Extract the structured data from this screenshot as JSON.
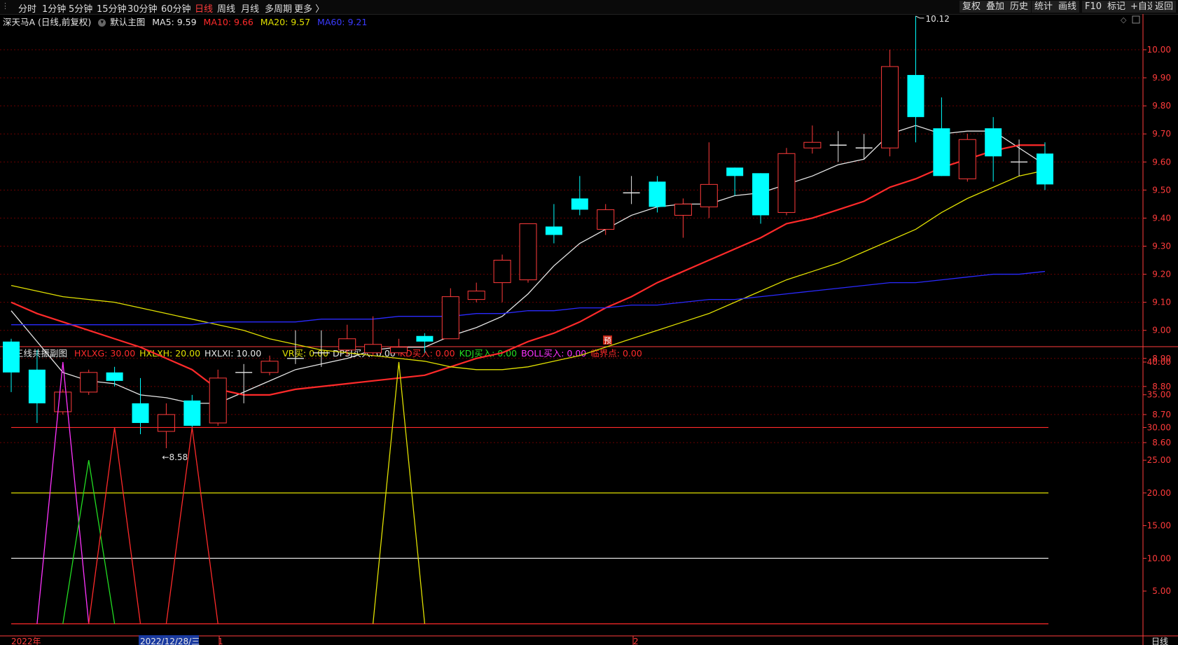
{
  "toolbar": {
    "left": [
      {
        "label": "分时",
        "active": false
      },
      {
        "label": "1分钟",
        "active": false
      },
      {
        "label": "5分钟",
        "active": false
      },
      {
        "label": "15分钟",
        "active": false
      },
      {
        "label": "30分钟",
        "active": false
      },
      {
        "label": "60分钟",
        "active": false
      },
      {
        "label": "日线",
        "active": true
      },
      {
        "label": "周线",
        "active": false
      },
      {
        "label": "月线",
        "active": false
      },
      {
        "label": "多周期",
        "active": false
      },
      {
        "label": "更多 〉",
        "active": false
      }
    ],
    "right": [
      "复权",
      "叠加",
      "历史",
      "统计",
      "画线",
      "F10",
      "标记",
      "+自选",
      "返回"
    ]
  },
  "main_info": {
    "stock": "深天马A (日线,前复权)",
    "template": "默认主图",
    "ma5": {
      "label": "MA5: 9.59",
      "color": "#e6e6e6"
    },
    "ma10": {
      "label": "MA10: 9.66",
      "color": "#ff2a2a"
    },
    "ma20": {
      "label": "MA20: 9.57",
      "color": "#e0e000"
    },
    "ma60": {
      "label": "MA60: 9.21",
      "color": "#2a2aff"
    }
  },
  "sub_info": {
    "title": "三线共振副图",
    "items": [
      {
        "label": "HXLXG: 30.00",
        "color": "#ff2a2a"
      },
      {
        "label": "HXLXH: 20.00",
        "color": "#e0e000"
      },
      {
        "label": "HXLXI: 10.00",
        "color": "#e6e6e6"
      },
      {
        "label": "VR买: 0.00",
        "color": "#e0e000"
      },
      {
        "label": "DPSJ买入: 0.00",
        "color": "#e6e6e6"
      },
      {
        "label": "KD买入: 0.00",
        "color": "#ff2a2a"
      },
      {
        "label": "KDJ买入: 0.00",
        "color": "#22dd22"
      },
      {
        "label": "BOLL买入: 0.00",
        "color": "#ff33ff"
      },
      {
        "label": "临界点: 0.00",
        "color": "#ff2a2a"
      }
    ]
  },
  "bottom": {
    "year_label": "2022年",
    "cursor_date": "2022/12/28/三",
    "month_1": "1",
    "month_2": "2",
    "period": "日线"
  },
  "marker_yu": "预",
  "colors": {
    "up": "#ff3b3b",
    "down": "#00ffff",
    "bg": "#000000",
    "grid": "#5a0000",
    "axis": "#ff3b3b"
  },
  "chart_data": [
    {
      "type": "candlestick",
      "title": "深天马A (日线,前复权)",
      "ylim": [
        8.55,
        10.2
      ],
      "yticks": [
        8.6,
        8.7,
        8.8,
        8.9,
        9.0,
        9.1,
        9.2,
        9.3,
        9.4,
        9.5,
        9.6,
        9.7,
        9.8,
        9.9,
        10.0
      ],
      "annotations": [
        {
          "text": "10.12",
          "index": 35,
          "kind": "high"
        },
        {
          "text": "8.58",
          "index": 6,
          "kind": "low"
        }
      ],
      "candles": [
        {
          "o": 8.96,
          "h": 8.97,
          "l": 8.78,
          "c": 8.85
        },
        {
          "o": 8.86,
          "h": 8.93,
          "l": 8.67,
          "c": 8.74
        },
        {
          "o": 8.71,
          "h": 8.79,
          "l": 8.7,
          "c": 8.78
        },
        {
          "o": 8.78,
          "h": 8.86,
          "l": 8.77,
          "c": 8.85
        },
        {
          "o": 8.85,
          "h": 8.87,
          "l": 8.8,
          "c": 8.82
        },
        {
          "o": 8.74,
          "h": 8.83,
          "l": 8.63,
          "c": 8.67
        },
        {
          "o": 8.64,
          "h": 8.74,
          "l": 8.58,
          "c": 8.7
        },
        {
          "o": 8.75,
          "h": 8.77,
          "l": 8.64,
          "c": 8.66
        },
        {
          "o": 8.67,
          "h": 8.86,
          "l": 8.66,
          "c": 8.83
        },
        {
          "o": 8.85,
          "h": 8.88,
          "l": 8.74,
          "c": 8.85
        },
        {
          "o": 8.85,
          "h": 8.91,
          "l": 8.84,
          "c": 8.89
        },
        {
          "o": 8.9,
          "h": 9.0,
          "l": 8.88,
          "c": 8.9
        },
        {
          "o": 8.92,
          "h": 9.0,
          "l": 8.87,
          "c": 8.92
        },
        {
          "o": 8.93,
          "h": 9.02,
          "l": 8.91,
          "c": 8.97
        },
        {
          "o": 8.92,
          "h": 9.05,
          "l": 8.91,
          "c": 8.95
        },
        {
          "o": 8.92,
          "h": 8.97,
          "l": 8.91,
          "c": 8.94
        },
        {
          "o": 8.98,
          "h": 8.99,
          "l": 8.92,
          "c": 8.96
        },
        {
          "o": 8.97,
          "h": 9.15,
          "l": 8.97,
          "c": 9.12
        },
        {
          "o": 9.11,
          "h": 9.17,
          "l": 9.1,
          "c": 9.14
        },
        {
          "o": 9.17,
          "h": 9.27,
          "l": 9.1,
          "c": 9.25
        },
        {
          "o": 9.18,
          "h": 9.38,
          "l": 9.17,
          "c": 9.38
        },
        {
          "o": 9.37,
          "h": 9.45,
          "l": 9.31,
          "c": 9.34
        },
        {
          "o": 9.47,
          "h": 9.55,
          "l": 9.41,
          "c": 9.43
        },
        {
          "o": 9.36,
          "h": 9.45,
          "l": 9.34,
          "c": 9.43
        },
        {
          "o": 9.48,
          "h": 9.55,
          "l": 9.45,
          "c": 9.49
        },
        {
          "o": 9.53,
          "h": 9.55,
          "l": 9.42,
          "c": 9.44
        },
        {
          "o": 9.41,
          "h": 9.47,
          "l": 9.33,
          "c": 9.45
        },
        {
          "o": 9.44,
          "h": 9.67,
          "l": 9.4,
          "c": 9.52
        },
        {
          "o": 9.58,
          "h": 9.58,
          "l": 9.48,
          "c": 9.55
        },
        {
          "o": 9.56,
          "h": 9.56,
          "l": 9.38,
          "c": 9.41
        },
        {
          "o": 9.42,
          "h": 9.65,
          "l": 9.41,
          "c": 9.63
        },
        {
          "o": 9.65,
          "h": 9.73,
          "l": 9.63,
          "c": 9.67
        },
        {
          "o": 9.66,
          "h": 9.71,
          "l": 9.6,
          "c": 9.66
        },
        {
          "o": 9.64,
          "h": 9.7,
          "l": 9.61,
          "c": 9.65
        },
        {
          "o": 9.65,
          "h": 10.0,
          "l": 9.62,
          "c": 9.94
        },
        {
          "o": 9.91,
          "h": 10.12,
          "l": 9.67,
          "c": 9.76
        },
        {
          "o": 9.72,
          "h": 9.83,
          "l": 9.55,
          "c": 9.55
        },
        {
          "o": 9.54,
          "h": 9.7,
          "l": 9.53,
          "c": 9.68
        },
        {
          "o": 9.72,
          "h": 9.76,
          "l": 9.53,
          "c": 9.62
        },
        {
          "o": 9.6,
          "h": 9.68,
          "l": 9.55,
          "c": 9.6
        },
        {
          "o": 9.63,
          "h": 9.67,
          "l": 9.5,
          "c": 9.52
        }
      ],
      "series": [
        {
          "name": "MA5",
          "color": "#e6e6e6",
          "values": [
            9.07,
            8.96,
            8.85,
            8.82,
            8.81,
            8.77,
            8.76,
            8.74,
            8.74,
            8.78,
            8.82,
            8.86,
            8.88,
            8.9,
            8.93,
            8.94,
            8.94,
            8.98,
            9.01,
            9.05,
            9.13,
            9.23,
            9.31,
            9.36,
            9.41,
            9.44,
            9.45,
            9.45,
            9.48,
            9.49,
            9.52,
            9.55,
            9.59,
            9.61,
            9.7,
            9.73,
            9.7,
            9.71,
            9.71,
            9.65,
            9.59
          ]
        },
        {
          "name": "MA10",
          "color": "#ff2a2a",
          "values": [
            9.1,
            9.06,
            9.03,
            9.0,
            8.97,
            8.94,
            8.9,
            8.86,
            8.79,
            8.77,
            8.77,
            8.79,
            8.8,
            8.81,
            8.82,
            8.83,
            8.84,
            8.87,
            8.9,
            8.92,
            8.96,
            8.99,
            9.03,
            9.08,
            9.12,
            9.17,
            9.21,
            9.25,
            9.29,
            9.33,
            9.38,
            9.4,
            9.43,
            9.46,
            9.51,
            9.54,
            9.58,
            9.61,
            9.64,
            9.66,
            9.66
          ]
        },
        {
          "name": "MA20",
          "color": "#e0e000",
          "values": [
            9.16,
            9.14,
            9.12,
            9.11,
            9.1,
            9.08,
            9.06,
            9.04,
            9.02,
            9.0,
            8.97,
            8.95,
            8.93,
            8.92,
            8.91,
            8.9,
            8.89,
            8.87,
            8.86,
            8.86,
            8.87,
            8.89,
            8.91,
            8.94,
            8.97,
            9.0,
            9.03,
            9.06,
            9.1,
            9.14,
            9.18,
            9.21,
            9.24,
            9.28,
            9.32,
            9.36,
            9.42,
            9.47,
            9.51,
            9.55,
            9.57
          ]
        },
        {
          "name": "MA60",
          "color": "#2a2aff",
          "values": [
            9.02,
            9.02,
            9.02,
            9.02,
            9.02,
            9.02,
            9.02,
            9.02,
            9.03,
            9.03,
            9.03,
            9.03,
            9.04,
            9.04,
            9.04,
            9.05,
            9.05,
            9.05,
            9.06,
            9.06,
            9.07,
            9.07,
            9.08,
            9.08,
            9.09,
            9.09,
            9.1,
            9.11,
            9.11,
            9.12,
            9.13,
            9.14,
            9.15,
            9.16,
            9.17,
            9.17,
            9.18,
            9.19,
            9.2,
            9.2,
            9.21
          ]
        }
      ]
    },
    {
      "type": "line",
      "title": "三线共振副图",
      "ylim": [
        0,
        41
      ],
      "yticks": [
        5,
        10,
        15,
        20,
        25,
        30,
        35,
        40
      ],
      "hlines": [
        {
          "name": "HXLXG",
          "value": 30,
          "color": "#ff2a2a"
        },
        {
          "name": "HXLXH",
          "value": 20,
          "color": "#e0e000"
        },
        {
          "name": "HXLXI",
          "value": 10,
          "color": "#e6e6e6"
        }
      ],
      "series": [
        {
          "name": "BOLL买入",
          "color": "#ff33ff",
          "points": [
            [
              1,
              0
            ],
            [
              2,
              40
            ],
            [
              3,
              0
            ]
          ]
        },
        {
          "name": "KDJ买入",
          "color": "#22dd22",
          "points": [
            [
              2,
              0
            ],
            [
              3,
              25
            ],
            [
              4,
              0
            ]
          ]
        },
        {
          "name": "KD买入",
          "color": "#ff2a2a",
          "points": [
            [
              3,
              0
            ],
            [
              4,
              30
            ],
            [
              5,
              0
            ]
          ]
        },
        {
          "name": "临界点",
          "color": "#ff2a2a",
          "points": [
            [
              6,
              0
            ],
            [
              7,
              30
            ],
            [
              8,
              0
            ]
          ]
        },
        {
          "name": "VR买",
          "color": "#e0e000",
          "points": [
            [
              14,
              0
            ],
            [
              15,
              40
            ],
            [
              16,
              0
            ]
          ]
        }
      ]
    }
  ]
}
